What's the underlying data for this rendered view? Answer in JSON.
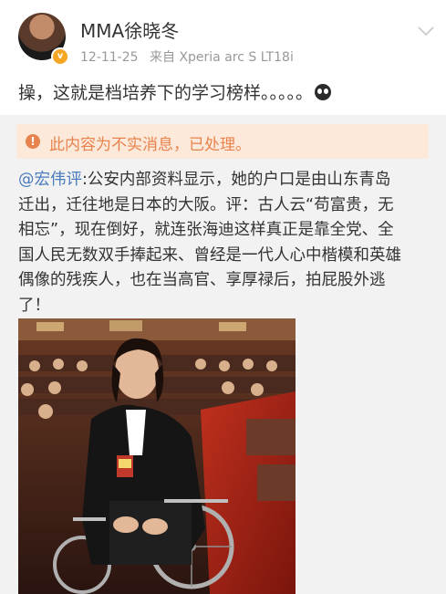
{
  "user": {
    "name": "MMA徐晓冬",
    "badge": "v"
  },
  "meta": {
    "date": "12-11-25",
    "source": "来自 Xperia arc S LT18i"
  },
  "post": {
    "text": "操，这就是档培养下的学习榜样。。。。。"
  },
  "repost": {
    "warning_icon": "!",
    "warning_text": "此内容为不实消息，已处理。",
    "mention": "@宏伟评",
    "lines": [
      ":公安内部资料显示，她的户口是由山东青岛",
      "迁出，迁往地是日本的大阪。评：古人云“苟富贵，无",
      "相忘”，现在倒好，就连张海迪这样真正是靠全党、全",
      "国人民无数双手捧起来、曾经是一代人心中楷模和英雄",
      "偶像的残疾人，也在当高官、享厚禄后，拍屁股外逃",
      "了！"
    ]
  },
  "icons": {
    "chevron": "chevron-down-icon",
    "emoji": "face-emoji-icon",
    "warning": "warning-icon",
    "verified": "verified-badge-icon"
  },
  "colors": {
    "mention": "#4a7bbd",
    "warning_text": "#e8834e",
    "warning_bg": "#fde9d9",
    "repost_bg": "#f2f2f2"
  }
}
